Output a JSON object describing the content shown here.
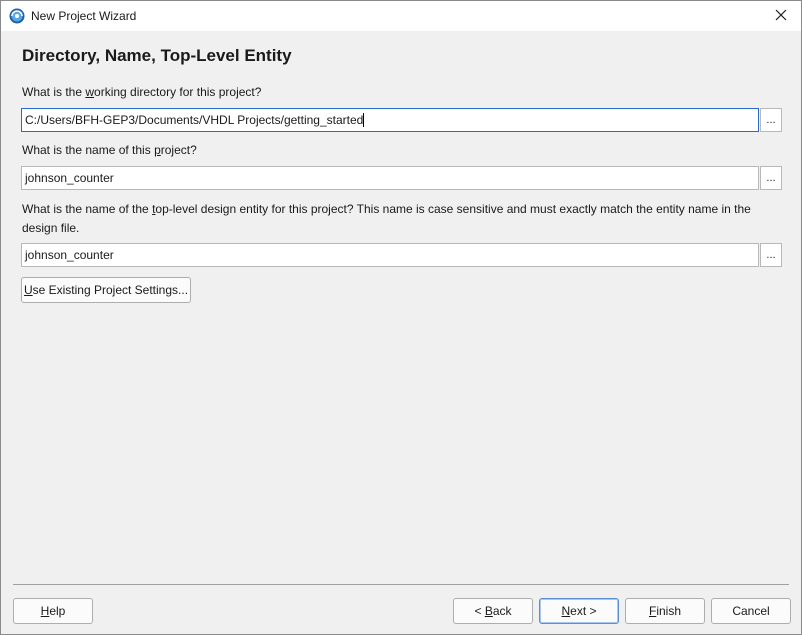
{
  "window": {
    "title": "New Project Wizard"
  },
  "page": {
    "heading": "Directory, Name, Top-Level Entity"
  },
  "directory": {
    "label_pre": "What is the ",
    "label_accel": "w",
    "label_post": "orking directory for this project?",
    "value": "C:/Users/BFH-GEP3/Documents/VHDL Projects/getting_started",
    "browse_label": "..."
  },
  "project_name": {
    "label_pre": "What is the name of this ",
    "label_accel": "p",
    "label_post": "roject?",
    "value": "johnson_counter",
    "browse_label": "..."
  },
  "top_level": {
    "label_pre": "What is the name of the ",
    "label_accel": "t",
    "label_post": "op-level design entity for this project? This name is case sensitive and must exactly match the entity name in the design file.",
    "value": "johnson_counter",
    "browse_label": "..."
  },
  "use_existing": {
    "accel": "U",
    "rest": "se Existing Project Settings..."
  },
  "footer": {
    "help": {
      "accel": "H",
      "rest": "elp"
    },
    "back": {
      "pre": "< ",
      "accel": "B",
      "rest": "ack"
    },
    "next": {
      "accel": "N",
      "rest": "ext >"
    },
    "finish": {
      "accel": "F",
      "rest": "inish"
    },
    "cancel": "Cancel"
  },
  "icons": {
    "app": "quartus-globe-icon",
    "close": "close-icon"
  },
  "colors": {
    "accent": "#2a6bc7",
    "background": "#f0f0f0"
  }
}
